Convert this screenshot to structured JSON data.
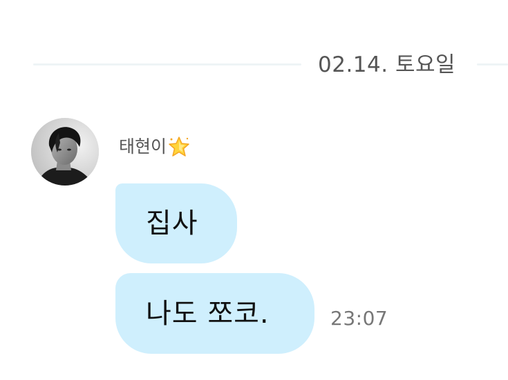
{
  "date_divider": {
    "label": "02.14. 토요일"
  },
  "sender": {
    "name": "태현이",
    "name_icon": "star-icon"
  },
  "messages": [
    {
      "text": "집사"
    },
    {
      "text": "나도 쪼코."
    }
  ],
  "last_message_time": "23:07",
  "colors": {
    "bubble": "#cfeffd",
    "divider": "#eef4f6",
    "date_text": "#555555",
    "timestamp_text": "#777777"
  }
}
